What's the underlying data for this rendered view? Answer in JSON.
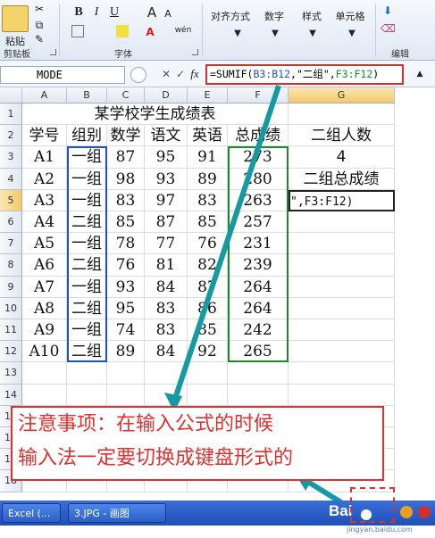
{
  "ribbon": {
    "paste_label": "粘贴",
    "clipboard_group": "剪贴板",
    "font_group": "字体",
    "bold": "B",
    "italic": "I",
    "underline": "U",
    "grow_font": "A",
    "shrink_font": "A",
    "font_color": "A",
    "phonetic": "wén",
    "alignment_label": "对齐方式",
    "number_label": "数字",
    "styles_label": "样式",
    "cells_label": "单元格",
    "editing_group": "编辑"
  },
  "formula_bar": {
    "name_box": "MODE",
    "formula_prefix": "=SUMIF(",
    "ref1": "B3:B12",
    "formula_mid": ",\"二组\",",
    "ref2": "F3:F12",
    "formula_suffix": ")",
    "cancel": "✕",
    "enter": "✓",
    "fx": "fx"
  },
  "columns": [
    "A",
    "B",
    "C",
    "D",
    "E",
    "F",
    "G"
  ],
  "rows": [
    "1",
    "2",
    "3",
    "4",
    "5",
    "6",
    "7",
    "8",
    "9",
    "10",
    "11",
    "12",
    "13",
    "14",
    "15",
    "16",
    "17",
    "18"
  ],
  "sheet": {
    "title": "某学校学生成绩表",
    "headers": [
      "学号",
      "组别",
      "数学",
      "语文",
      "英语",
      "总成绩",
      "二组人数"
    ],
    "data": [
      [
        "A1",
        "一组",
        "87",
        "95",
        "91",
        "273",
        "4"
      ],
      [
        "A2",
        "一组",
        "98",
        "93",
        "89",
        "280",
        "二组总成绩"
      ],
      [
        "A3",
        "一组",
        "83",
        "97",
        "83",
        "263",
        "\",F3:F12)"
      ],
      [
        "A4",
        "二组",
        "85",
        "87",
        "85",
        "257",
        ""
      ],
      [
        "A5",
        "一组",
        "78",
        "77",
        "76",
        "231",
        ""
      ],
      [
        "A6",
        "二组",
        "76",
        "81",
        "82",
        "239",
        ""
      ],
      [
        "A7",
        "一组",
        "93",
        "84",
        "87",
        "264",
        ""
      ],
      [
        "A8",
        "二组",
        "95",
        "83",
        "86",
        "264",
        ""
      ],
      [
        "A9",
        "一组",
        "74",
        "83",
        "85",
        "242",
        ""
      ],
      [
        "A10",
        "二组",
        "89",
        "84",
        "92",
        "265",
        ""
      ]
    ]
  },
  "note": {
    "line1": "注意事项：在输入公式的时候",
    "line2": "输入法一定要切换成键盘形式的"
  },
  "taskbar": {
    "excel_task": "Excel (...",
    "paint_task": "3.JPG - 画图",
    "watermark": "Bai",
    "watermark_sub": "jingyan.baidu.com"
  }
}
